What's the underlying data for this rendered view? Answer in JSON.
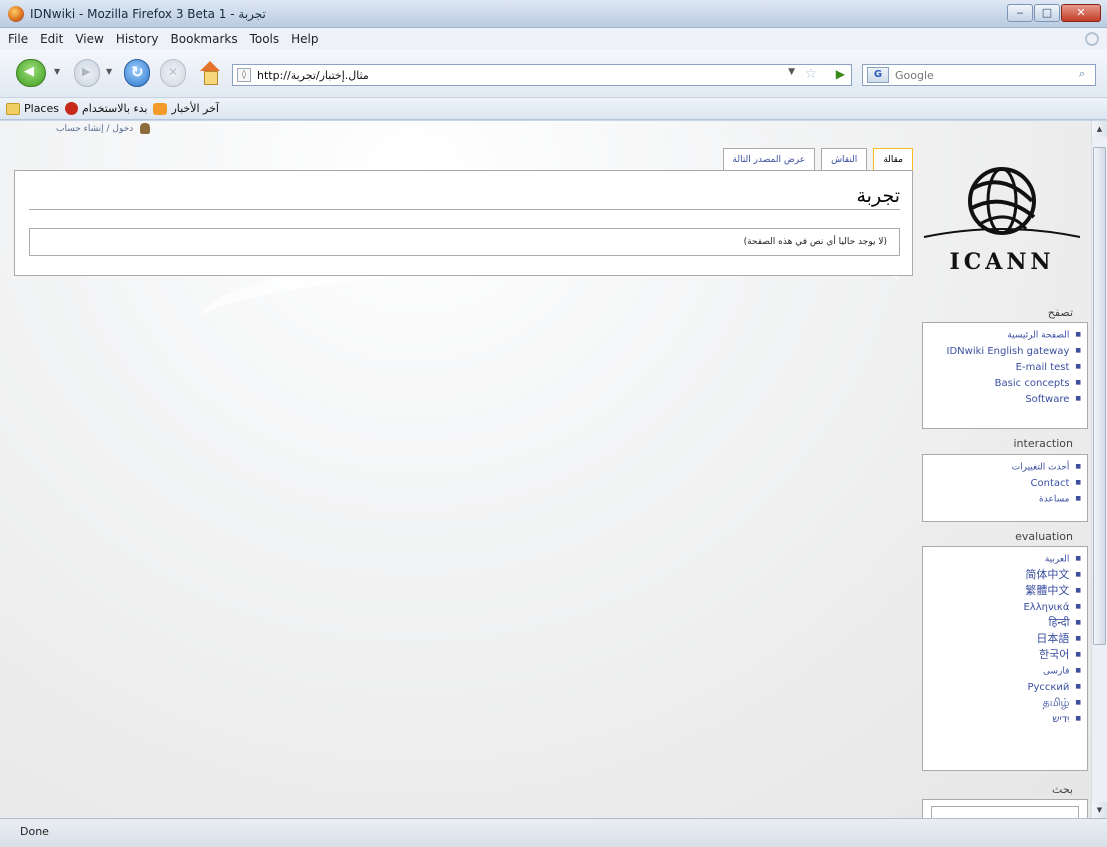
{
  "window": {
    "title": "تجربة - IDNwiki - Mozilla Firefox 3 Beta 1",
    "minimize": "‒",
    "maximize": "□",
    "close": "✕"
  },
  "menu": [
    "File",
    "Edit",
    "View",
    "History",
    "Bookmarks",
    "Tools",
    "Help"
  ],
  "navbar": {
    "url": "http://مثال.إختبار/تجربة",
    "search_placeholder": "Google",
    "search_engine_icon": "G",
    "icons": [
      "back-icon",
      "forward-icon",
      "reload-icon",
      "stop-icon",
      "home-icon",
      "star-icon",
      "go-icon",
      "search-icon"
    ]
  },
  "bookmarks": [
    {
      "label": "Places",
      "icon": "folder-icon"
    },
    {
      "label": "بدء بالاستخدام",
      "icon": "tomato-icon"
    },
    {
      "label": "آخر الأخبار",
      "icon": "rss-icon"
    }
  ],
  "page": {
    "personal_tools": "دخول / إنشاء حساب",
    "tabs": [
      "مقالة",
      "النقاش",
      "عرض المصدر التالة"
    ],
    "heading": "تجربة",
    "notice": "(لا يوجد حاليا أي نص في هذه الصفحة)",
    "logo_text": "ICANN",
    "nav_title": "تصفح",
    "nav_items": [
      "الصفحة الرئيسية",
      "IDNwiki English gateway",
      "E-mail test",
      "Basic concepts",
      "Software"
    ],
    "interaction_title": "interaction",
    "interaction_items": [
      "أحدث التغييرات",
      "Contact",
      "مساعدة"
    ],
    "evaluation_title": "evaluation",
    "evaluation_items": [
      "العربية",
      "简体中文",
      "繁體中文",
      "Ελληνικά",
      "हिन्दी",
      "日本語",
      "한국어",
      "فارسی",
      "Русский",
      "தமிழ்",
      "יִדיש"
    ],
    "search_title": "بحث"
  },
  "status": "Done",
  "colors": {
    "link": "#3a4fa0",
    "tab_selected_border": "#fabd23",
    "content_border": "#aaaaaa"
  }
}
